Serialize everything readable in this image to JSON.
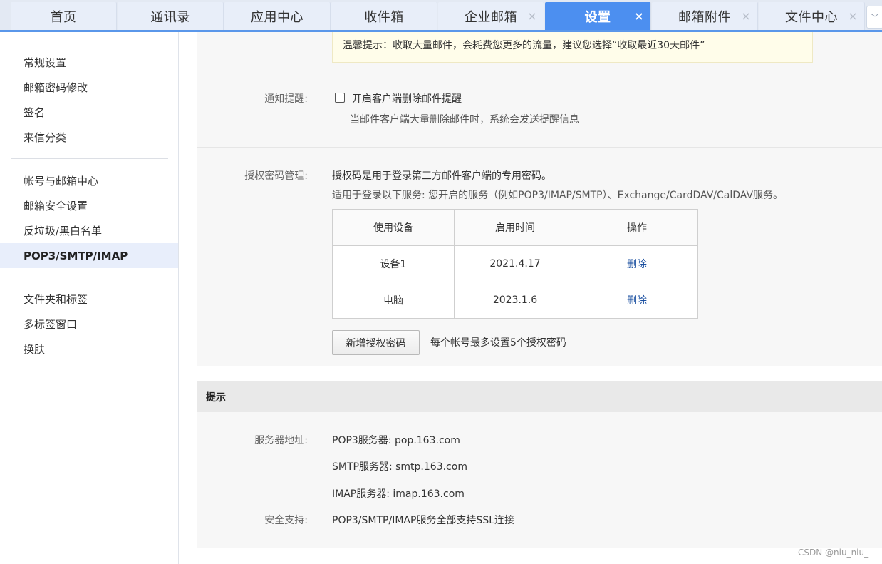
{
  "tabs": [
    {
      "label": "首页",
      "closable": false,
      "active": false
    },
    {
      "label": "通讯录",
      "closable": false,
      "active": false
    },
    {
      "label": "应用中心",
      "closable": false,
      "active": false
    },
    {
      "label": "收件箱",
      "closable": false,
      "active": false
    },
    {
      "label": "企业邮箱",
      "closable": true,
      "active": false
    },
    {
      "label": "设置",
      "closable": true,
      "active": true
    },
    {
      "label": "邮箱附件",
      "closable": true,
      "active": false
    },
    {
      "label": "文件中心",
      "closable": true,
      "active": false
    }
  ],
  "tab_close_glyph": "×",
  "tab_more_glyph": "﹀",
  "sidebar": {
    "groups": [
      [
        "常规设置",
        "邮箱密码修改",
        "签名",
        "来信分类"
      ],
      [
        "帐号与邮箱中心",
        "邮箱安全设置",
        "反垃圾/黑白名单",
        "POP3/SMTP/IMAP"
      ],
      [
        "文件夹和标签",
        "多标签窗口",
        "换肤"
      ]
    ],
    "active": "POP3/SMTP/IMAP"
  },
  "notice": "温馨提示：收取大量邮件，会耗费您更多的流量，建议您选择“收取最近30天邮件”",
  "notify": {
    "label": "通知提醒:",
    "checkbox_label": "开启客户端删除邮件提醒",
    "checked": false,
    "hint": "当邮件客户端大量删除邮件时，系统会发送提醒信息"
  },
  "auth": {
    "label": "授权密码管理:",
    "desc": "授权码是用于登录第三方邮件客户端的专用密码。",
    "sub": "适用于登录以下服务: 您开启的服务（例如POP3/IMAP/SMTP）、Exchange/CardDAV/CalDAV服务。",
    "columns": [
      "使用设备",
      "启用时间",
      "操作"
    ],
    "rows": [
      {
        "device": "设备1",
        "date": "2021.4.17",
        "action": "删除"
      },
      {
        "device": "电脑",
        "date": "2023.1.6",
        "action": "删除"
      }
    ],
    "add_button": "新增授权密码",
    "limit_note": "每个帐号最多设置5个授权密码"
  },
  "tips": {
    "title": "提示",
    "server_label": "服务器地址:",
    "pop3": "POP3服务器: pop.163.com",
    "smtp": "SMTP服务器: smtp.163.com",
    "imap": "IMAP服务器: imap.163.com",
    "security_label": "安全支持:",
    "security": "POP3/SMTP/IMAP服务全部支持SSL连接"
  },
  "watermark": "CSDN @niu_niu_",
  "colors": {
    "accent": "#4c8ff0",
    "link": "#1a4fa0",
    "notice_bg": "#fffdea"
  }
}
